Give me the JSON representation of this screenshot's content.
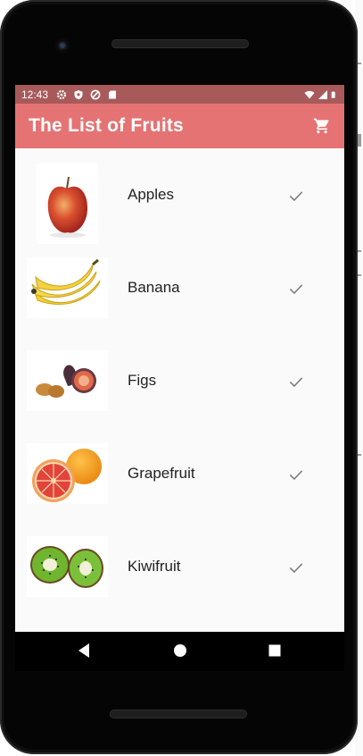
{
  "status_bar": {
    "time": "12:43"
  },
  "app_bar": {
    "title": "The List of Fruits",
    "accent": "#e57373",
    "icon": "cart-icon"
  },
  "fruits": [
    {
      "name": "Apples",
      "icon": "check-icon"
    },
    {
      "name": "Banana",
      "icon": "check-icon"
    },
    {
      "name": "Figs",
      "icon": "check-icon"
    },
    {
      "name": "Grapefruit",
      "icon": "check-icon"
    },
    {
      "name": "Kiwifruit",
      "icon": "check-icon"
    }
  ],
  "nav_bar": {
    "back": "back-icon",
    "home": "home-icon",
    "recents": "recents-icon"
  }
}
